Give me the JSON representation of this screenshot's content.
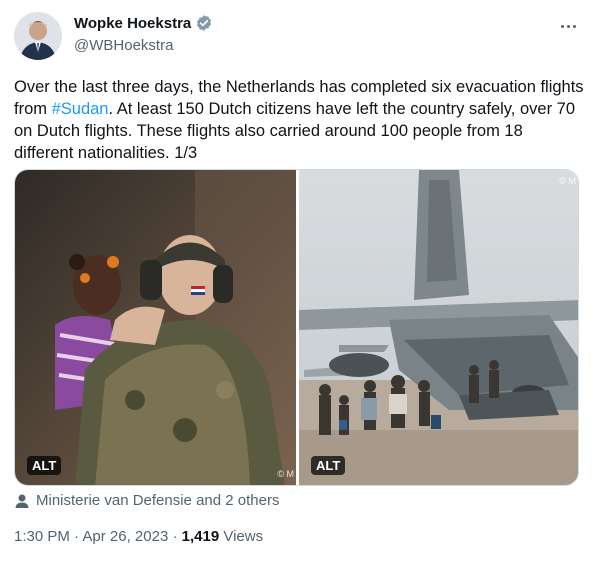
{
  "author": {
    "name": "Wopke Hoekstra",
    "handle": "@WBHoekstra",
    "verified": true
  },
  "tweet": {
    "text_before": "Over the last three days, the Netherlands has completed six evacuation flights from ",
    "hashtag": "#Sudan",
    "text_after": ". At least 150 Dutch citizens have left the country safely, over 70 on Dutch flights. These flights also carried around 100 people from 18 different nationalities. 1/3"
  },
  "media": {
    "photos": [
      {
        "alt_label": "ALT",
        "watermark": "© M"
      },
      {
        "alt_label": "ALT",
        "watermark": "© M"
      }
    ]
  },
  "tagged": {
    "text": "Ministerie van Defensie and 2 others"
  },
  "meta": {
    "time": "1:30 PM",
    "separator1": " · ",
    "date": "Apr 26, 2023",
    "separator2": " · ",
    "views_count": "1,419",
    "views_label": " Views"
  },
  "colors": {
    "accent": "#1d9bf0",
    "secondary_text": "#536471",
    "primary_text": "#0f1419"
  }
}
